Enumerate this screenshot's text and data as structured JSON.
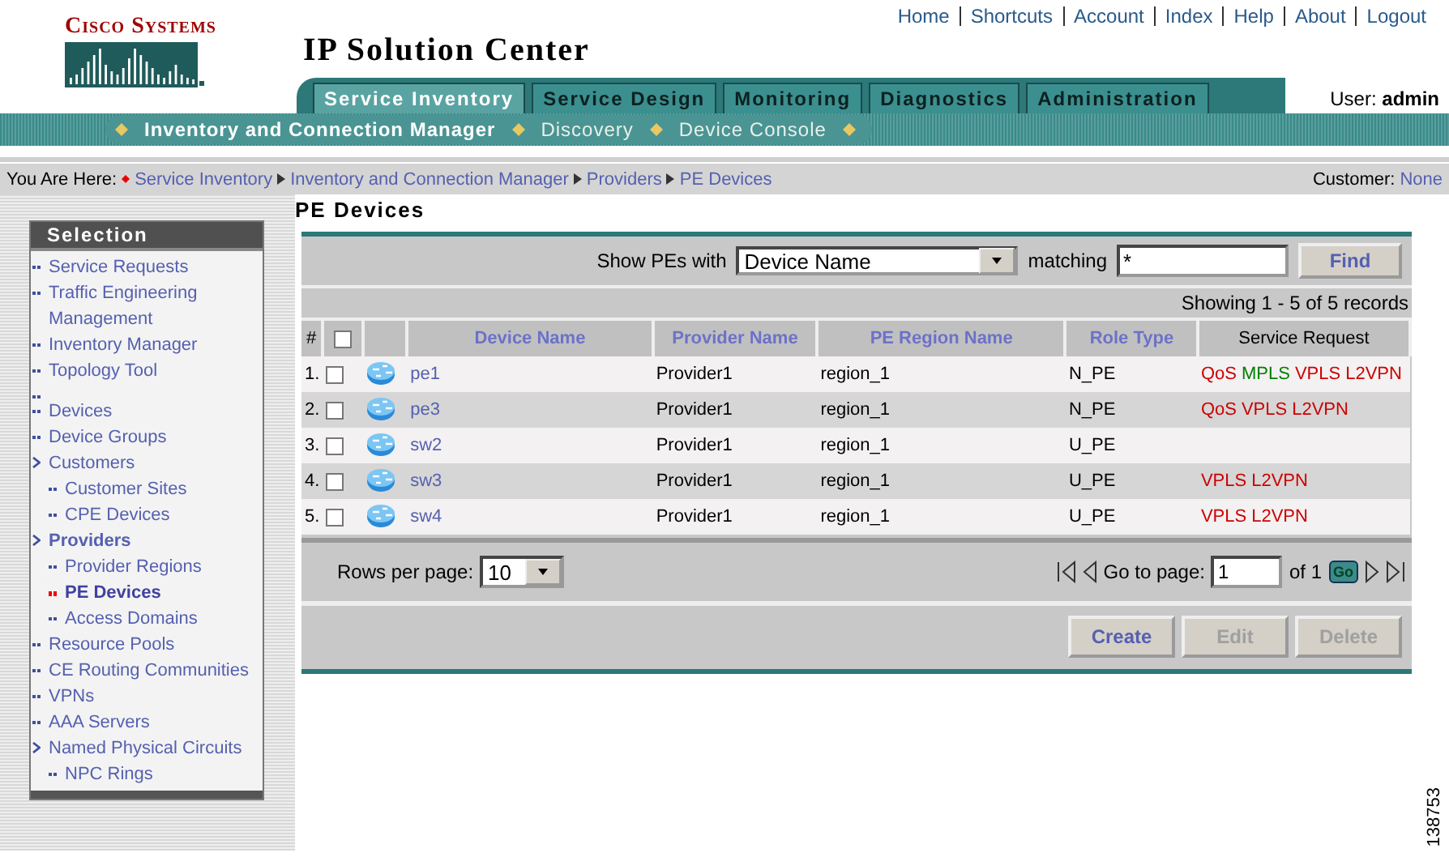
{
  "header": {
    "logo": "Cisco Systems",
    "title": "IP Solution Center",
    "links": [
      "Home",
      "Shortcuts",
      "Account",
      "Index",
      "Help",
      "About",
      "Logout"
    ],
    "user_label": "User:",
    "user": "admin"
  },
  "tabs": [
    {
      "label": "Service Inventory",
      "selected": true
    },
    {
      "label": "Service Design",
      "selected": false
    },
    {
      "label": "Monitoring",
      "selected": false
    },
    {
      "label": "Diagnostics",
      "selected": false
    },
    {
      "label": "Administration",
      "selected": false
    }
  ],
  "subnav": [
    {
      "label": "Inventory and Connection Manager",
      "selected": true
    },
    {
      "label": "Discovery",
      "selected": false
    },
    {
      "label": "Device Console",
      "selected": false
    }
  ],
  "breadcrumb": {
    "label": "You Are Here:",
    "items": [
      "Service Inventory",
      "Inventory and Connection Manager",
      "Providers",
      "PE Devices"
    ],
    "customer_label": "Customer:",
    "customer": "None"
  },
  "sidebar": {
    "title": "Selection",
    "items": [
      {
        "kind": "link",
        "label": "Service Requests",
        "selected": false
      },
      {
        "kind": "link",
        "label": "Traffic Engineering Management",
        "selected": false
      },
      {
        "kind": "link",
        "label": "Inventory Manager",
        "selected": false
      },
      {
        "kind": "link",
        "label": "Topology Tool",
        "selected": false
      },
      {
        "kind": "blank"
      },
      {
        "kind": "link",
        "label": "Devices",
        "selected": false
      },
      {
        "kind": "link",
        "label": "Device Groups",
        "selected": false
      },
      {
        "kind": "group",
        "label": "Customers",
        "active": false,
        "children": [
          {
            "label": "Customer Sites",
            "selected": false
          },
          {
            "label": "CPE Devices",
            "selected": false
          }
        ]
      },
      {
        "kind": "group",
        "label": "Providers",
        "active": true,
        "children": [
          {
            "label": "Provider Regions",
            "selected": false
          },
          {
            "label": "PE Devices",
            "selected": true
          },
          {
            "label": "Access Domains",
            "selected": false
          }
        ]
      },
      {
        "kind": "link",
        "label": "Resource Pools",
        "selected": false
      },
      {
        "kind": "link",
        "label": "CE Routing Communities",
        "selected": false
      },
      {
        "kind": "link",
        "label": "VPNs",
        "selected": false
      },
      {
        "kind": "link",
        "label": "AAA Servers",
        "selected": false
      },
      {
        "kind": "group",
        "label": "Named Physical Circuits",
        "active": false,
        "children": [
          {
            "label": "NPC Rings",
            "selected": false
          }
        ]
      }
    ]
  },
  "page_title": "PE Devices",
  "filter": {
    "label": "Show PEs with",
    "field": "Device Name",
    "matching_label": "matching",
    "value": "*",
    "button": "Find"
  },
  "records": "Showing 1 - 5 of 5 records",
  "table": {
    "all_checked": false,
    "columns": [
      {
        "label": "#",
        "sortable": false
      },
      {
        "label": "Device Name",
        "sortable": true
      },
      {
        "label": "Provider Name",
        "sortable": true
      },
      {
        "label": "PE Region Name",
        "sortable": true
      },
      {
        "label": "Role Type",
        "sortable": true
      },
      {
        "label": "Service Request",
        "sortable": false
      }
    ],
    "rows": [
      {
        "index": "1.",
        "checked": false,
        "device": "pe1",
        "provider": "Provider1",
        "region": "region_1",
        "role": "N_PE",
        "services": [
          {
            "label": "QoS",
            "color": "#cc0000"
          },
          {
            "label": "MPLS",
            "color": "#008000"
          },
          {
            "label": "VPLS",
            "color": "#cc0000"
          },
          {
            "label": "L2VPN",
            "color": "#cc0000"
          }
        ]
      },
      {
        "index": "2.",
        "checked": false,
        "device": "pe3",
        "provider": "Provider1",
        "region": "region_1",
        "role": "N_PE",
        "services": [
          {
            "label": "QoS",
            "color": "#cc0000"
          },
          {
            "label": "VPLS",
            "color": "#cc0000"
          },
          {
            "label": "L2VPN",
            "color": "#cc0000"
          }
        ]
      },
      {
        "index": "3.",
        "checked": false,
        "device": "sw2",
        "provider": "Provider1",
        "region": "region_1",
        "role": "U_PE"
      },
      {
        "index": "4.",
        "checked": false,
        "device": "sw3",
        "provider": "Provider1",
        "region": "region_1",
        "role": "U_PE",
        "services": [
          {
            "label": "VPLS",
            "color": "#cc0000"
          },
          {
            "label": "L2VPN",
            "color": "#cc0000"
          }
        ]
      },
      {
        "index": "5.",
        "checked": false,
        "device": "sw4",
        "provider": "Provider1",
        "region": "region_1",
        "role": "U_PE",
        "services": [
          {
            "label": "VPLS",
            "color": "#cc0000"
          },
          {
            "label": "L2VPN",
            "color": "#cc0000"
          }
        ]
      }
    ]
  },
  "pager": {
    "rows_label": "Rows per page:",
    "rows_per_page": "10",
    "goto_label": "Go to page:",
    "page": "1",
    "of": "of 1",
    "go": "Go"
  },
  "buttons": [
    {
      "label": "Create",
      "disabled": false
    },
    {
      "label": "Edit",
      "disabled": true
    },
    {
      "label": "Delete",
      "disabled": true
    }
  ],
  "figure_id": "138753"
}
